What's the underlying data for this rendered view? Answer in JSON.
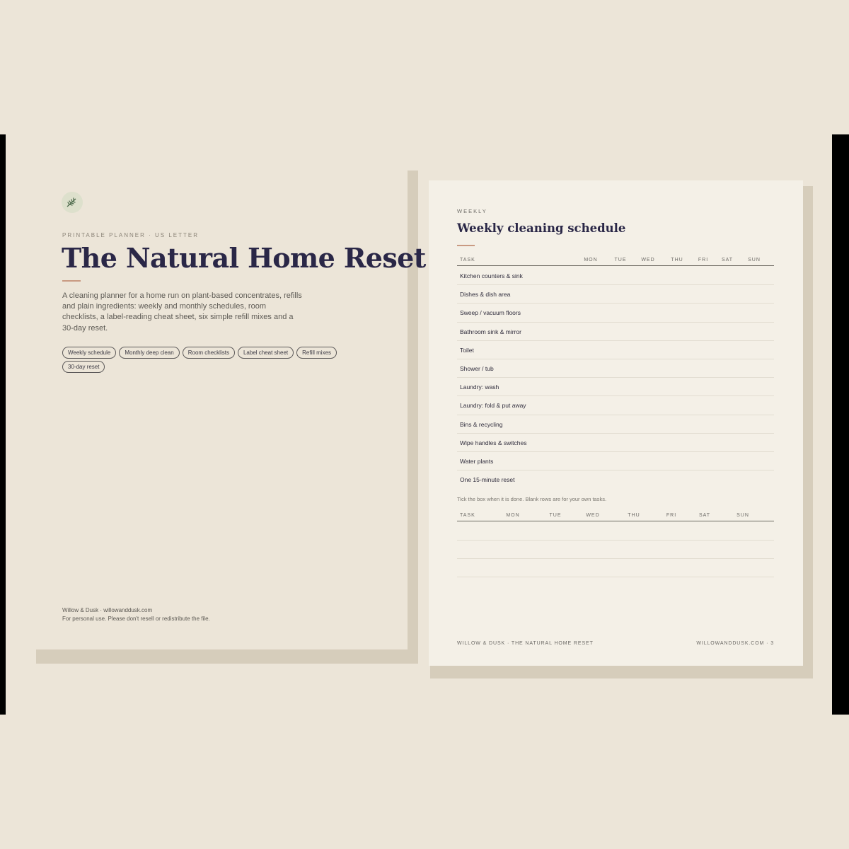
{
  "cover": {
    "logo_icon": "sprig-icon",
    "kicker": "PRINTABLE PLANNER · US LETTER",
    "title": "The Natural Home Reset",
    "description": "A cleaning planner for a home run on plant-based concentrates, refills and plain ingredients: weekly and monthly schedules, room checklists, a label-reading cheat sheet, six simple refill mixes and a 30-day reset.",
    "chips": [
      "Weekly schedule",
      "Monthly deep clean",
      "Room checklists",
      "Label cheat sheet",
      "Refill mixes",
      "30-day reset"
    ],
    "footer_line1": "Willow & Dusk · willowanddusk.com",
    "footer_line2": "For personal use. Please don't resell or redistribute the file."
  },
  "schedule": {
    "kicker": "WEEKLY",
    "title": "Weekly cleaning schedule",
    "columns": [
      "TASK",
      "MON",
      "TUE",
      "WED",
      "THU",
      "FRI",
      "SAT",
      "SUN"
    ],
    "tasks": [
      "Kitchen counters & sink",
      "Dishes & dish area",
      "Sweep / vacuum floors",
      "Bathroom sink & mirror",
      "Toilet",
      "Shower / tub",
      "Laundry: wash",
      "Laundry: fold & put away",
      "Bins & recycling",
      "Wipe handles & switches",
      "Water plants",
      "One 15-minute reset"
    ],
    "note": "Tick the box when it is done. Blank rows are for your own tasks.",
    "footer_left": "WILLOW & DUSK · THE NATURAL HOME RESET",
    "footer_right": "WILLOWANDDUSK.COM · 3"
  },
  "colors": {
    "background": "#ece5d8",
    "title_ink": "#2a2747",
    "accent_rule": "#c99a82",
    "page_paper": "#f4f0e7",
    "shadow": "#d6cdbb"
  }
}
